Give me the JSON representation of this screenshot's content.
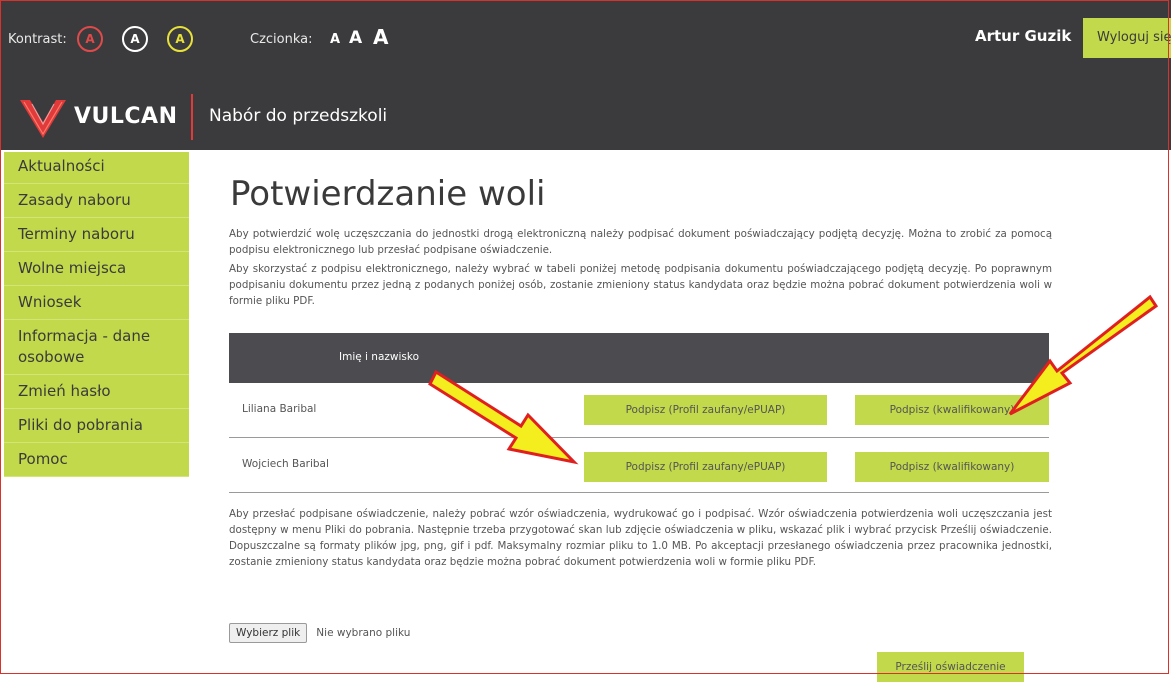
{
  "header": {
    "contrast_label": "Kontrast:",
    "contrast_options": [
      "A",
      "A",
      "A"
    ],
    "font_label": "Czcionka:",
    "font_sizes": [
      "A",
      "A",
      "A"
    ],
    "user_name": "Artur Guzik",
    "logout_label": "Wyloguj się"
  },
  "brand": {
    "name": "VULCAN",
    "app_title": "Nabór do przedszkoli"
  },
  "sidebar": {
    "items": [
      {
        "label": "Aktualności"
      },
      {
        "label": "Zasady naboru"
      },
      {
        "label": "Terminy naboru"
      },
      {
        "label": "Wolne miejsca"
      },
      {
        "label": "Wniosek"
      },
      {
        "label": "Informacja - dane osobowe"
      },
      {
        "label": "Zmień hasło"
      },
      {
        "label": "Pliki do pobrania"
      },
      {
        "label": "Pomoc"
      }
    ]
  },
  "main": {
    "title": "Potwierdzanie woli",
    "intro": "Aby potwierdzić wolę uczęszczania do jednostki drogą elektroniczną należy podpisać dokument poświadczający podjętą decyzję. Można to zrobić za pomocą podpisu elektronicznego lub przesłać podpisane oświadczenie.",
    "instructions": "Aby skorzystać z podpisu elektronicznego, należy wybrać w tabeli poniżej metodę podpisania dokumentu poświadczającego podjętą decyzję. Po poprawnym podpisaniu dokumentu przez jedną z podanych poniżej osób, zostanie zmieniony status kandydata oraz będzie można pobrać dokument potwierdzenia woli w formie pliku PDF.",
    "table": {
      "header": "Imię i nazwisko",
      "rows": [
        {
          "name": "Liliana Baribal",
          "sign_profile": "Podpisz (Profil zaufany/ePUAP)",
          "sign_qualified": "Podpisz (kwalifikowany)"
        },
        {
          "name": "Wojciech Baribal",
          "sign_profile": "Podpisz (Profil zaufany/ePUAP)",
          "sign_qualified": "Podpisz (kwalifikowany)"
        }
      ]
    },
    "upload_info": "Aby przesłać podpisane oświadczenie, należy pobrać wzór oświadczenia, wydrukować go i podpisać. Wzór oświadczenia potwierdzenia woli uczęszczania jest dostępny w menu Pliki do pobrania. Następnie trzeba przygotować skan lub zdjęcie oświadczenia w pliku, wskazać plik i wybrać przycisk Prześlij oświadczenie. Dopuszczalne są formaty plików jpg, png, gif i pdf. Maksymalny rozmiar pliku to 1.0 MB. Po akceptacji przesłanego oświadczenia przez pracownika jednostki, zostanie zmieniony status kandydata oraz będzie można pobrać dokument potwierdzenia woli w formie pliku PDF.",
    "file_button": "Wybierz plik",
    "file_status": "Nie wybrano pliku",
    "submit_label": "Prześlij oświadczenie"
  },
  "colors": {
    "header_bg": "#3b3b3d",
    "accent_green": "#c1d94a",
    "brand_red": "#e03a3a",
    "table_header_bg": "#4b4b50",
    "annotation_arrow": "#f5ee1f"
  }
}
